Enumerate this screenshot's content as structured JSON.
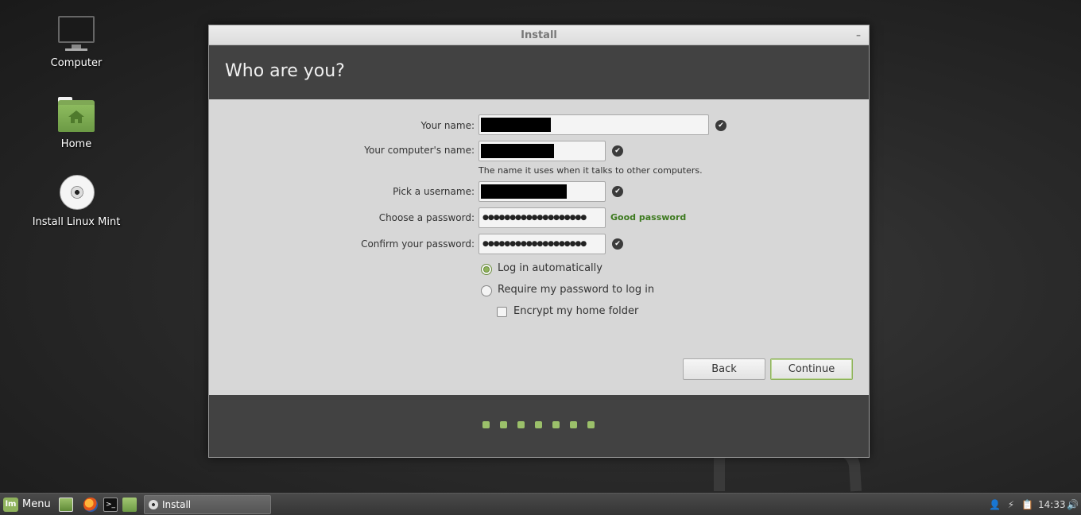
{
  "desktop": {
    "icons": [
      {
        "label": "Computer",
        "icon": "computer-icon"
      },
      {
        "label": "Home",
        "icon": "home-folder-icon"
      },
      {
        "label": "Install Linux Mint",
        "icon": "cd-icon"
      }
    ]
  },
  "window": {
    "title": "Install",
    "minimize_glyph": "–",
    "heading": "Who are you?"
  },
  "form": {
    "your_name_label": "Your name:",
    "computer_name_label": "Your computer's name:",
    "computer_name_hint": "The name it uses when it talks to other computers.",
    "username_label": "Pick a username:",
    "password_label": "Choose a password:",
    "password_value": "●●●●●●●●●●●●●●●●●●●",
    "password_strength": "Good password",
    "confirm_label": "Confirm your password:",
    "confirm_value": "●●●●●●●●●●●●●●●●●●●",
    "login_auto_label": "Log in automatically",
    "login_password_label": "Require my password to log in",
    "encrypt_label": "Encrypt my home folder",
    "selected_login": "auto",
    "encrypt_checked": false
  },
  "buttons": {
    "back_label": "Back",
    "continue_label": "Continue"
  },
  "progress": {
    "total_steps": 7
  },
  "taskbar": {
    "menu_label": "Menu",
    "task_label": "Install",
    "clock": "14:33"
  },
  "colors": {
    "accent": "#8fb35c",
    "strength_good": "#3d7a1f",
    "header_band": "#424242"
  }
}
